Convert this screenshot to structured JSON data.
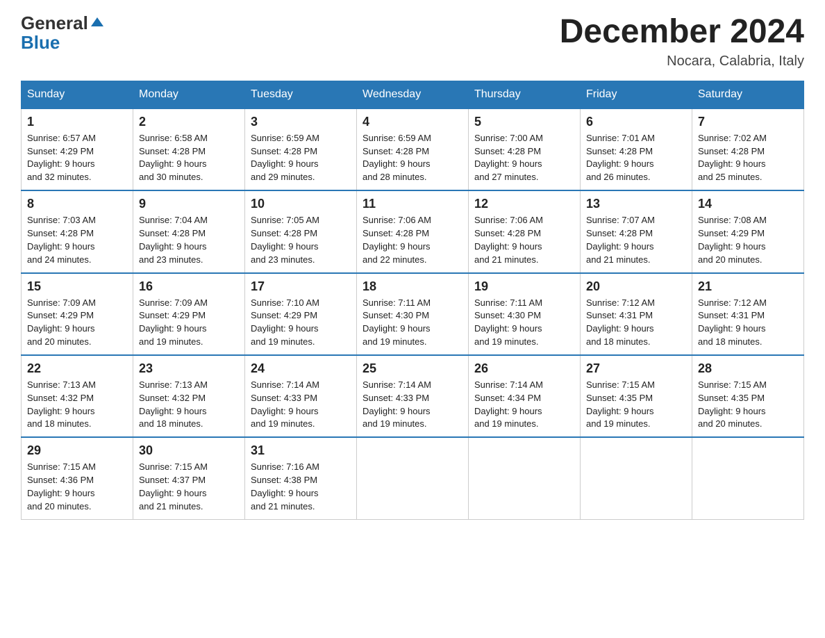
{
  "logo": {
    "general": "General",
    "blue": "Blue",
    "triangle": "▲"
  },
  "title": "December 2024",
  "subtitle": "Nocara, Calabria, Italy",
  "days_of_week": [
    "Sunday",
    "Monday",
    "Tuesday",
    "Wednesday",
    "Thursday",
    "Friday",
    "Saturday"
  ],
  "weeks": [
    [
      {
        "day": "1",
        "info": "Sunrise: 6:57 AM\nSunset: 4:29 PM\nDaylight: 9 hours\nand 32 minutes."
      },
      {
        "day": "2",
        "info": "Sunrise: 6:58 AM\nSunset: 4:28 PM\nDaylight: 9 hours\nand 30 minutes."
      },
      {
        "day": "3",
        "info": "Sunrise: 6:59 AM\nSunset: 4:28 PM\nDaylight: 9 hours\nand 29 minutes."
      },
      {
        "day": "4",
        "info": "Sunrise: 6:59 AM\nSunset: 4:28 PM\nDaylight: 9 hours\nand 28 minutes."
      },
      {
        "day": "5",
        "info": "Sunrise: 7:00 AM\nSunset: 4:28 PM\nDaylight: 9 hours\nand 27 minutes."
      },
      {
        "day": "6",
        "info": "Sunrise: 7:01 AM\nSunset: 4:28 PM\nDaylight: 9 hours\nand 26 minutes."
      },
      {
        "day": "7",
        "info": "Sunrise: 7:02 AM\nSunset: 4:28 PM\nDaylight: 9 hours\nand 25 minutes."
      }
    ],
    [
      {
        "day": "8",
        "info": "Sunrise: 7:03 AM\nSunset: 4:28 PM\nDaylight: 9 hours\nand 24 minutes."
      },
      {
        "day": "9",
        "info": "Sunrise: 7:04 AM\nSunset: 4:28 PM\nDaylight: 9 hours\nand 23 minutes."
      },
      {
        "day": "10",
        "info": "Sunrise: 7:05 AM\nSunset: 4:28 PM\nDaylight: 9 hours\nand 23 minutes."
      },
      {
        "day": "11",
        "info": "Sunrise: 7:06 AM\nSunset: 4:28 PM\nDaylight: 9 hours\nand 22 minutes."
      },
      {
        "day": "12",
        "info": "Sunrise: 7:06 AM\nSunset: 4:28 PM\nDaylight: 9 hours\nand 21 minutes."
      },
      {
        "day": "13",
        "info": "Sunrise: 7:07 AM\nSunset: 4:28 PM\nDaylight: 9 hours\nand 21 minutes."
      },
      {
        "day": "14",
        "info": "Sunrise: 7:08 AM\nSunset: 4:29 PM\nDaylight: 9 hours\nand 20 minutes."
      }
    ],
    [
      {
        "day": "15",
        "info": "Sunrise: 7:09 AM\nSunset: 4:29 PM\nDaylight: 9 hours\nand 20 minutes."
      },
      {
        "day": "16",
        "info": "Sunrise: 7:09 AM\nSunset: 4:29 PM\nDaylight: 9 hours\nand 19 minutes."
      },
      {
        "day": "17",
        "info": "Sunrise: 7:10 AM\nSunset: 4:29 PM\nDaylight: 9 hours\nand 19 minutes."
      },
      {
        "day": "18",
        "info": "Sunrise: 7:11 AM\nSunset: 4:30 PM\nDaylight: 9 hours\nand 19 minutes."
      },
      {
        "day": "19",
        "info": "Sunrise: 7:11 AM\nSunset: 4:30 PM\nDaylight: 9 hours\nand 19 minutes."
      },
      {
        "day": "20",
        "info": "Sunrise: 7:12 AM\nSunset: 4:31 PM\nDaylight: 9 hours\nand 18 minutes."
      },
      {
        "day": "21",
        "info": "Sunrise: 7:12 AM\nSunset: 4:31 PM\nDaylight: 9 hours\nand 18 minutes."
      }
    ],
    [
      {
        "day": "22",
        "info": "Sunrise: 7:13 AM\nSunset: 4:32 PM\nDaylight: 9 hours\nand 18 minutes."
      },
      {
        "day": "23",
        "info": "Sunrise: 7:13 AM\nSunset: 4:32 PM\nDaylight: 9 hours\nand 18 minutes."
      },
      {
        "day": "24",
        "info": "Sunrise: 7:14 AM\nSunset: 4:33 PM\nDaylight: 9 hours\nand 19 minutes."
      },
      {
        "day": "25",
        "info": "Sunrise: 7:14 AM\nSunset: 4:33 PM\nDaylight: 9 hours\nand 19 minutes."
      },
      {
        "day": "26",
        "info": "Sunrise: 7:14 AM\nSunset: 4:34 PM\nDaylight: 9 hours\nand 19 minutes."
      },
      {
        "day": "27",
        "info": "Sunrise: 7:15 AM\nSunset: 4:35 PM\nDaylight: 9 hours\nand 19 minutes."
      },
      {
        "day": "28",
        "info": "Sunrise: 7:15 AM\nSunset: 4:35 PM\nDaylight: 9 hours\nand 20 minutes."
      }
    ],
    [
      {
        "day": "29",
        "info": "Sunrise: 7:15 AM\nSunset: 4:36 PM\nDaylight: 9 hours\nand 20 minutes."
      },
      {
        "day": "30",
        "info": "Sunrise: 7:15 AM\nSunset: 4:37 PM\nDaylight: 9 hours\nand 21 minutes."
      },
      {
        "day": "31",
        "info": "Sunrise: 7:16 AM\nSunset: 4:38 PM\nDaylight: 9 hours\nand 21 minutes."
      },
      null,
      null,
      null,
      null
    ]
  ]
}
